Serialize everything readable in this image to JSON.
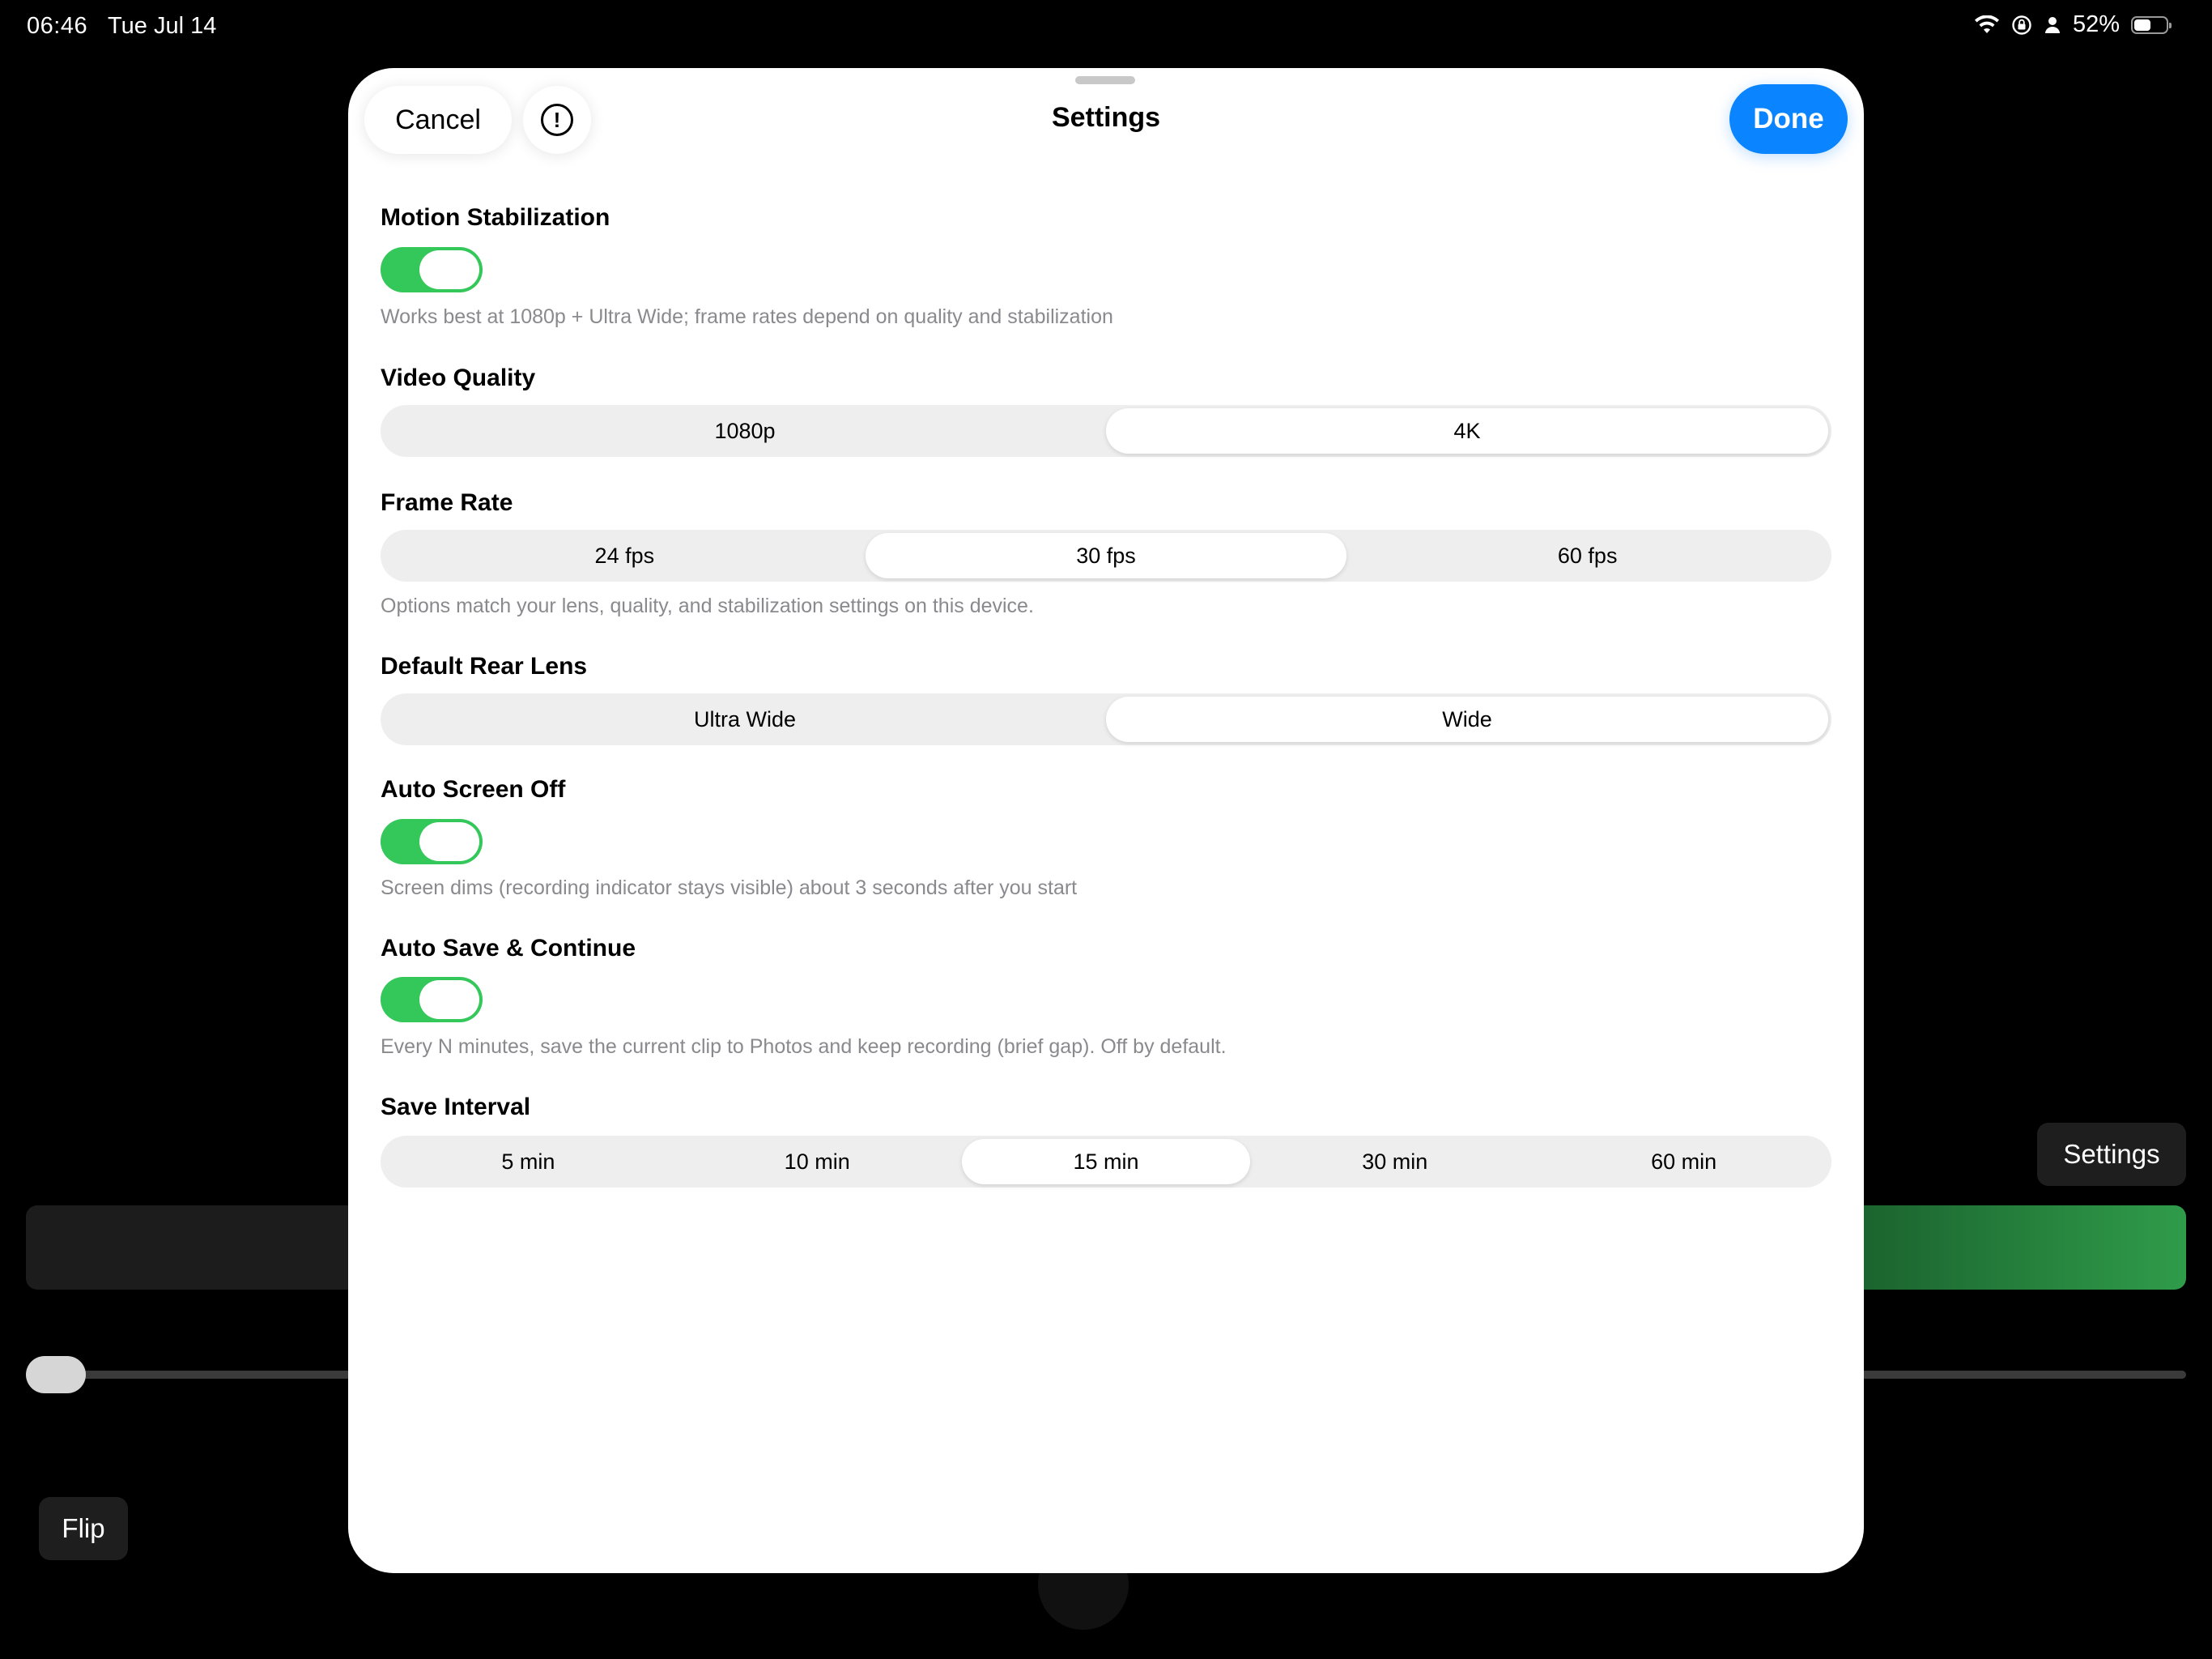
{
  "status_bar": {
    "time": "06:46",
    "date": "Tue Jul 14",
    "battery_percent": "52%",
    "battery_level": 0.52
  },
  "background": {
    "settings_label": "Settings",
    "flip_label": "Flip"
  },
  "sheet": {
    "title": "Settings",
    "cancel_label": "Cancel",
    "info_glyph": "!",
    "done_label": "Done"
  },
  "settings": {
    "motion_stabilization": {
      "title": "Motion Stabilization",
      "on": true,
      "caption": "Works best at 1080p + Ultra Wide; frame rates depend on quality and stabilization"
    },
    "video_quality": {
      "title": "Video Quality",
      "options": [
        "1080p",
        "4K"
      ],
      "selected": 1
    },
    "frame_rate": {
      "title": "Frame Rate",
      "options": [
        "24 fps",
        "30 fps",
        "60 fps"
      ],
      "selected": 1,
      "caption": "Options match your lens, quality, and stabilization settings on this device."
    },
    "default_rear_lens": {
      "title": "Default Rear Lens",
      "options": [
        "Ultra Wide",
        "Wide"
      ],
      "selected": 1
    },
    "auto_screen_off": {
      "title": "Auto Screen Off",
      "on": true,
      "caption": "Screen dims (recording indicator stays visible) about 3 seconds after you start"
    },
    "auto_save_continue": {
      "title": "Auto Save & Continue",
      "on": true,
      "caption": "Every N minutes, save the current clip to Photos and keep recording (brief gap). Off by default."
    },
    "save_interval": {
      "title": "Save Interval",
      "options": [
        "5 min",
        "10 min",
        "15 min",
        "30 min",
        "60 min"
      ],
      "selected": 2
    }
  },
  "colors": {
    "accent": "#0a84ff",
    "toggle_on": "#34c759"
  }
}
